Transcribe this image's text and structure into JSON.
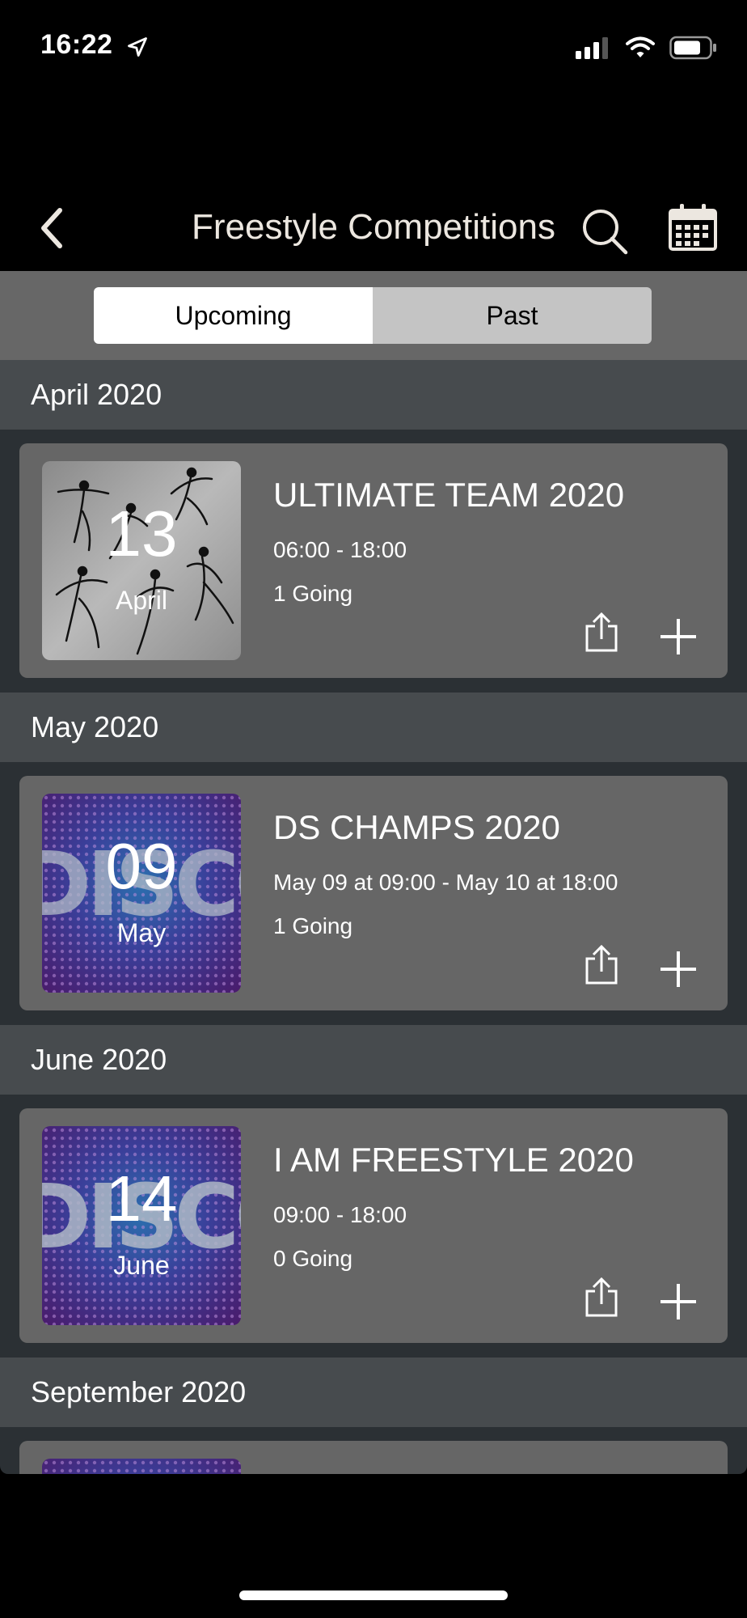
{
  "status_bar": {
    "time": "16:22"
  },
  "nav": {
    "title": "Freestyle Competitions"
  },
  "segments": {
    "upcoming": "Upcoming",
    "past": "Past",
    "selected": "Upcoming"
  },
  "sections": [
    {
      "month": "April 2020",
      "event": {
        "title": "ULTIMATE TEAM 2020",
        "time": "06:00 - 18:00",
        "going": "1 Going",
        "day": "13",
        "day_month": "April",
        "thumbnail": "dancers-image"
      }
    },
    {
      "month": "May 2020",
      "event": {
        "title": "DS CHAMPS 2020",
        "time": "May 09 at 09:00 - May 10 at 18:00",
        "going": "1 Going",
        "day": "09",
        "day_month": "May",
        "thumbnail": "disco-image"
      }
    },
    {
      "month": "June 2020",
      "event": {
        "title": "I AM FREESTYLE 2020",
        "time": "09:00 - 18:00",
        "going": "0 Going",
        "day": "14",
        "day_month": "June",
        "thumbnail": "disco-image"
      }
    },
    {
      "month": "September 2020"
    }
  ],
  "icons": {
    "back": "chevron-left-icon",
    "search": "search-icon",
    "calendar": "calendar-icon",
    "share": "share-icon",
    "add": "plus-icon"
  },
  "colors": {
    "nav_background": "#000000",
    "segment_bar": "#676767",
    "month_header": "#474b4e",
    "card": "#666666",
    "list_background": "#2b3034"
  }
}
